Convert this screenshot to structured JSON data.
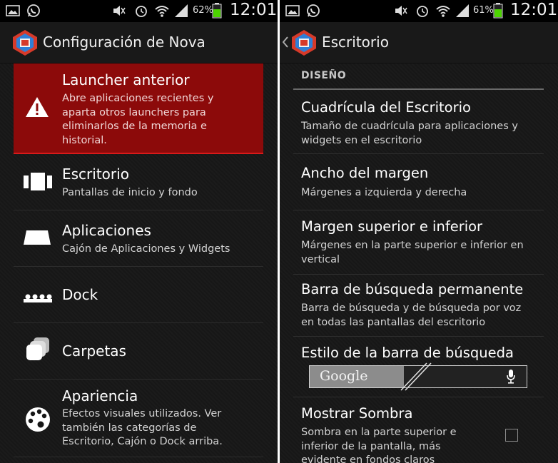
{
  "left": {
    "status": {
      "battery": "62%",
      "time": "12:01"
    },
    "title": "Configuración de Nova",
    "items": [
      {
        "title": "Launcher anterior",
        "subtitle": "Abre aplicaciones recientes y aparta otros launchers para eliminarlos de la memoria e historial.",
        "icon": "warning-icon"
      },
      {
        "title": "Escritorio",
        "subtitle": "Pantallas de inicio y fondo",
        "icon": "desktop-icon"
      },
      {
        "title": "Aplicaciones",
        "subtitle": "Cajón de Aplicaciones y Widgets",
        "icon": "apps-drawer-icon"
      },
      {
        "title": "Dock",
        "subtitle": "",
        "icon": "dock-icon"
      },
      {
        "title": "Carpetas",
        "subtitle": "",
        "icon": "folder-icon"
      },
      {
        "title": "Apariencia",
        "subtitle": "Efectos visuales utilizados. Ver también las categorías de Escritorio, Cajón o Dock arriba.",
        "icon": "palette-icon"
      }
    ]
  },
  "right": {
    "status": {
      "battery": "61%",
      "time": "12:01"
    },
    "title": "Escritorio",
    "section": "DISEÑO",
    "items": [
      {
        "title": "Cuadrícula del Escritorio",
        "subtitle": "Tamaño de cuadrícula para aplicaciones y widgets en el escritorio"
      },
      {
        "title": "Ancho del margen",
        "subtitle": "Márgenes a izquierda y derecha"
      },
      {
        "title": "Margen superior e inferior",
        "subtitle": "Márgenes en la parte superior e inferior en vertical"
      },
      {
        "title": "Barra de búsqueda permanente",
        "subtitle": "Barra de búsqueda y de búsqueda por voz en todas las pantallas del escritorio"
      },
      {
        "title": "Estilo de la barra de búsqueda",
        "subtitle": ""
      },
      {
        "title": "Mostrar Sombra",
        "subtitle": "Sombra en la parte superior e inferior de la pantalla, más evidente en fondos claros",
        "checked": false
      }
    ],
    "search_style_preview": {
      "brand_text": "Google",
      "icon": "microphone-icon"
    }
  },
  "colors": {
    "highlight": "#8c0a0a",
    "battery": "#4cd400",
    "background": "#161616"
  }
}
